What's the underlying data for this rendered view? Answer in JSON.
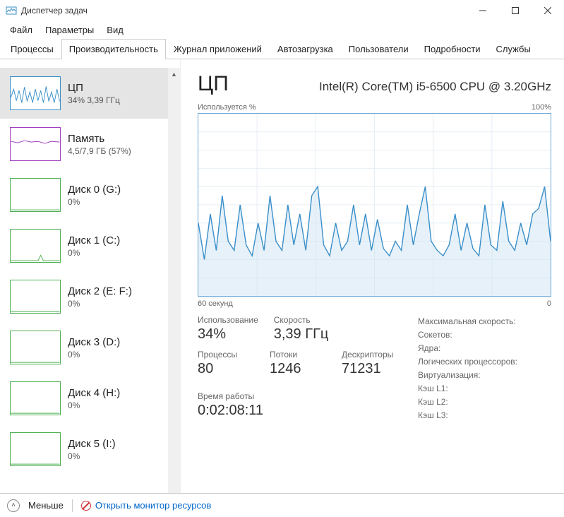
{
  "window": {
    "title": "Диспетчер задач"
  },
  "menu": {
    "file": "Файл",
    "options": "Параметры",
    "view": "Вид"
  },
  "tabs": {
    "processes": "Процессы",
    "performance": "Производительность",
    "apphistory": "Журнал приложений",
    "startup": "Автозагрузка",
    "users": "Пользователи",
    "details": "Подробности",
    "services": "Службы"
  },
  "sidebar": [
    {
      "title": "ЦП",
      "sub": "34% 3,39 ГГц",
      "color": "#3a8fc9"
    },
    {
      "title": "Память",
      "sub": "4,5/7,9 ГБ (57%)",
      "color": "#a040c0"
    },
    {
      "title": "Диск 0 (G:)",
      "sub": "0%",
      "color": "#4caf50"
    },
    {
      "title": "Диск 1 (C:)",
      "sub": "0%",
      "color": "#4caf50"
    },
    {
      "title": "Диск 2 (E: F:)",
      "sub": "0%",
      "color": "#4caf50"
    },
    {
      "title": "Диск 3 (D:)",
      "sub": "0%",
      "color": "#4caf50"
    },
    {
      "title": "Диск 4 (H:)",
      "sub": "0%",
      "color": "#4caf50"
    },
    {
      "title": "Диск 5 (I:)",
      "sub": "0%",
      "color": "#4caf50"
    }
  ],
  "main": {
    "title": "ЦП",
    "subtitle": "Intel(R) Core(TM) i5-6500 CPU @ 3.20GHz",
    "chart_top_left": "Используется %",
    "chart_top_right": "100%",
    "axis_left": "60 секунд",
    "axis_right": "0",
    "usage_label": "Использование",
    "usage_value": "34%",
    "speed_label": "Скорость",
    "speed_value": "3,39 ГГц",
    "proc_label": "Процессы",
    "proc_value": "80",
    "threads_label": "Потоки",
    "threads_value": "1246",
    "handles_label": "Дескрипторы",
    "handles_value": "71231",
    "uptime_label": "Время работы",
    "uptime_value": "0:02:08:11",
    "maxspeed": "Максимальная скорость:",
    "sockets": "Сокетов:",
    "cores": "Ядра:",
    "lp": "Логических процессоров:",
    "virt": "Виртуализация:",
    "l1": "Кэш L1:",
    "l2": "Кэш L2:",
    "l3": "Кэш L3:"
  },
  "footer": {
    "less": "Меньше",
    "monitor": "Открыть монитор ресурсов"
  },
  "chart_data": {
    "type": "line",
    "title": "Используется %",
    "xlabel": "60 секунд → 0",
    "ylabel": "%",
    "ylim": [
      0,
      100
    ],
    "series": [
      {
        "name": "ЦП %",
        "values": [
          40,
          20,
          45,
          25,
          55,
          30,
          25,
          50,
          28,
          22,
          40,
          25,
          55,
          30,
          25,
          50,
          28,
          45,
          25,
          55,
          60,
          28,
          22,
          40,
          25,
          30,
          50,
          28,
          45,
          25,
          42,
          26,
          22,
          30,
          25,
          50,
          28,
          45,
          60,
          30,
          25,
          22,
          28,
          45,
          25,
          40,
          26,
          22,
          50,
          28,
          25,
          52,
          30,
          25,
          40,
          28,
          45,
          48,
          60,
          30
        ]
      }
    ]
  }
}
